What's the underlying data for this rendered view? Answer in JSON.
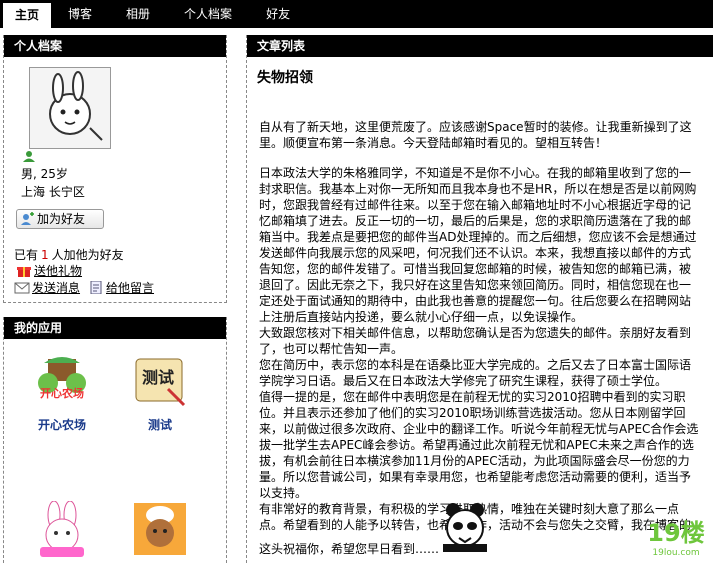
{
  "nav": {
    "items": [
      "主页",
      "博客",
      "相册",
      "个人档案",
      "好友"
    ],
    "active_index": 0
  },
  "profile": {
    "title": "个人档案",
    "gender_age": "男, 25岁",
    "location": "上海 长宁区",
    "add_friend_label": "加为好友",
    "friend_prefix": "已有",
    "friend_count": "1",
    "friend_suffix": "人加他为好友",
    "send_gift": "送他礼物",
    "send_message": "发送消息",
    "leave_comment": "给他留言"
  },
  "apps": {
    "title": "我的应用",
    "items": [
      {
        "name": "开心农场",
        "icon": "farm-icon",
        "logo_text": "开心农场"
      },
      {
        "name": "测试",
        "icon": "quiz-icon",
        "logo_text": "测试"
      },
      {
        "name": "",
        "icon": "rabbit-icon",
        "logo_text": ""
      },
      {
        "name": "",
        "icon": "chef-icon",
        "logo_text": ""
      }
    ]
  },
  "articles": {
    "title": "文章列表",
    "post_title": "失物招领",
    "paragraphs": [
      "自从有了新天地，这里便荒废了。应该感谢Space暂时的装修。让我重新操到了这里。顺便宣布第一条消息。今天登陆邮箱时看见的。望相互转告！",
      "日本政法大学的朱格雅同学，不知道是不是你不小心。在我的邮箱里收到了您的一封求职信。我基本上对你一无所知而且我本身也不是HR，所以在想是否是以前网购时，您跟我曾经有过邮件往来。以至于您在输入邮箱地址时不小心根据近字母的记忆邮箱填了进去。反正一切的一切，最后的后果是，您的求职简历遗落在了我的邮箱当中。我差点是要把您的邮件当AD处理掉的。而之后细想，您应该不会是想通过发送邮件向我展示您的风采吧，何况我们还不认识。本来，我想直接以邮件的方式告知您，您的邮件发错了。可惜当我回复您邮箱的时候，被告知您的邮箱已满，被退回了。因此无奈之下，我只好在这里告知您来领回简历。同时，相信您现在也一定还处于面试通知的期待中，由此我也善意的提醒您一句。往后您要么在招聘网站上注册后直接站内投递，要么就小心仔细一点，以免误操作。",
      "大致跟您核对下相关邮件信息，以帮助您确认是否为您遗失的邮件。亲朋好友看到了，也可以帮忙告知一声。",
      "您在简历中，表示您的本科是在语桑比亚大学完成的。之后又去了日本富士国际语学院学习日语。最后又在日本政法大学修完了研究生课程，获得了硕士学位。",
      "值得一提的是，您在邮件中表明您是在前程无忧的实习2010招聘中看到的实习职位。并且表示还参加了他们的实习2010职场训练营选拔活动。您从日本刚留学回来，以前做过很多次政府、企业中的翻译工作。听说今年前程无忧与APEC合作会选拔一批学生去APEC峰会参访。希望再通过此次前程无忧和APEC未来之声合作的选拔，有机会前往日本横滨参加11月份的APEC活动，为此项国际盛会尽一份您的力量。所以您昔诚公司，如果有幸录用您，也希望能考虑您活动需要的便利，适当予以支持。",
      "有非常好的教育背景，有积极的学习进取热情，唯独在关键时刻大意了那么一点点。希望看到的人能予以转告，也希望工作，活动不会与您失之交臂，我在博客的"
    ],
    "closing": "这头祝福你，希望您早日看到……"
  },
  "watermark": {
    "text": "19楼",
    "sub": "19lou.com"
  },
  "colors": {
    "header_bg": "#000000",
    "app_name": "#1a3a8a",
    "count": "#cc0000",
    "watermark": "#6ec63c"
  }
}
